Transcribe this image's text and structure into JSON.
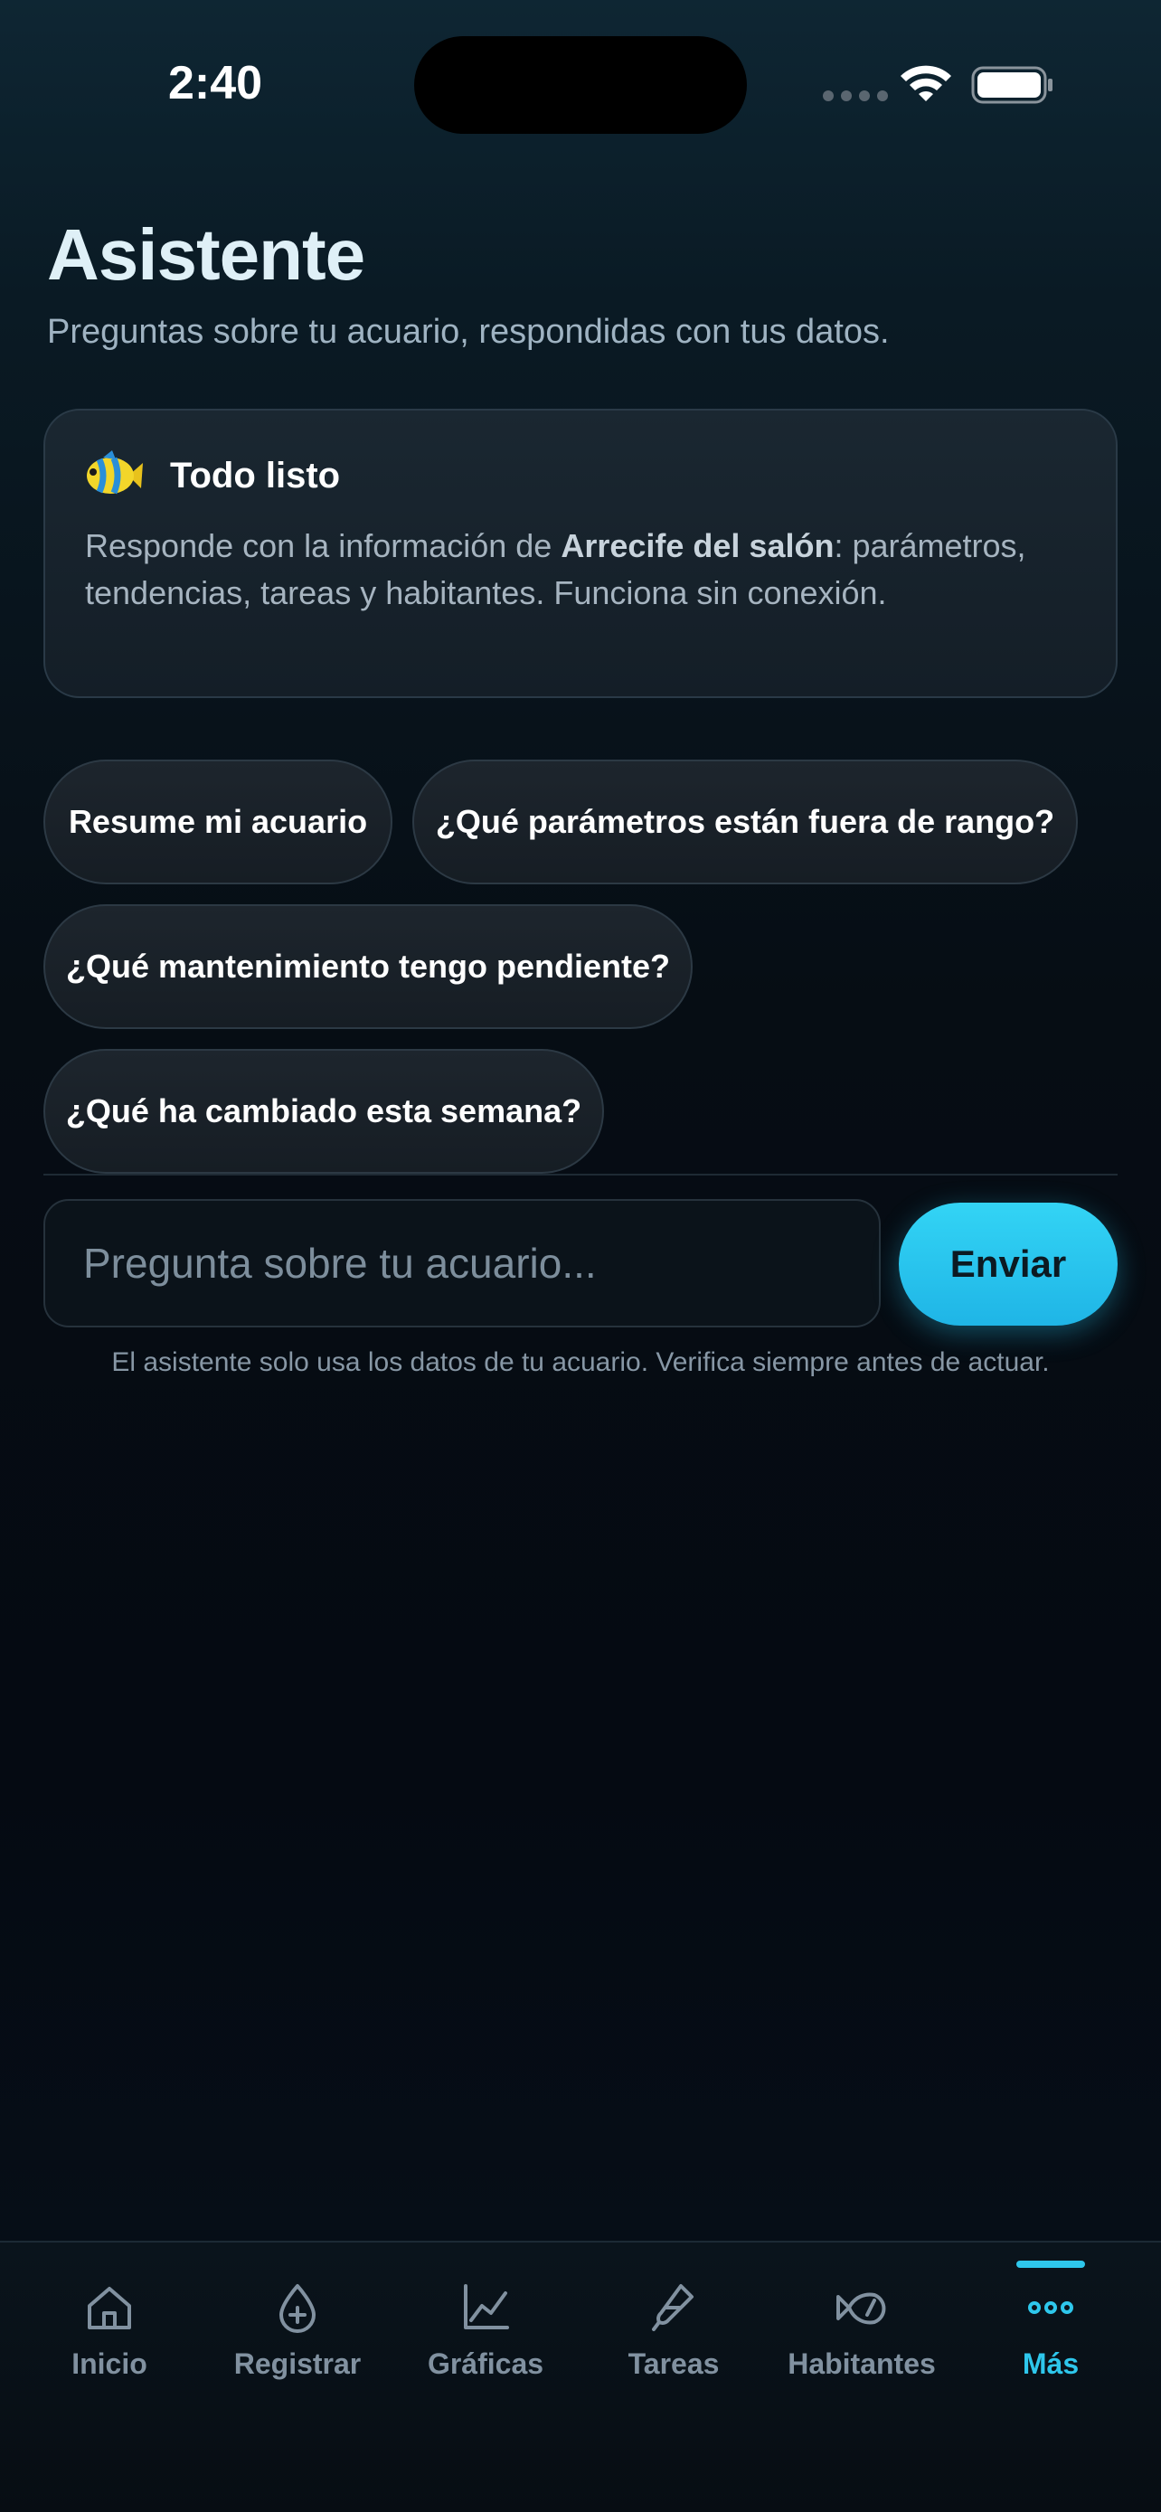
{
  "status_bar": {
    "time": "2:40"
  },
  "header": {
    "title": "Asistente",
    "subtitle": "Preguntas sobre tu acuario, respondidas con tus datos."
  },
  "status_card": {
    "icon": "tropical-fish-icon",
    "title": "Todo listo",
    "body_prefix": "Responde con la información de ",
    "aquarium_name": "Arrecife del salón",
    "body_suffix": ": parámetros, tendencias, tareas y habitantes. Funciona sin conexión."
  },
  "suggestions": [
    "Resume mi acuario",
    "¿Qué parámetros están fuera de rango?",
    "¿Qué mantenimiento tengo pendiente?",
    "¿Qué ha cambiado esta semana?"
  ],
  "composer": {
    "placeholder": "Pregunta sobre tu acuario...",
    "send_label": "Enviar"
  },
  "disclaimer": "El asistente solo usa los datos de tu acuario. Verifica siempre antes de actuar.",
  "tab_bar": {
    "items": [
      {
        "label": "Inicio",
        "icon": "home-icon"
      },
      {
        "label": "Registrar",
        "icon": "drop-plus-icon"
      },
      {
        "label": "Gráficas",
        "icon": "line-chart-icon"
      },
      {
        "label": "Tareas",
        "icon": "dropper-icon"
      },
      {
        "label": "Habitantes",
        "icon": "fish-icon"
      },
      {
        "label": "Más",
        "icon": "more-icon"
      }
    ],
    "active": "Más"
  },
  "colors": {
    "accent": "#2ec7ec",
    "background": "#050a12",
    "card": "#18232c"
  }
}
